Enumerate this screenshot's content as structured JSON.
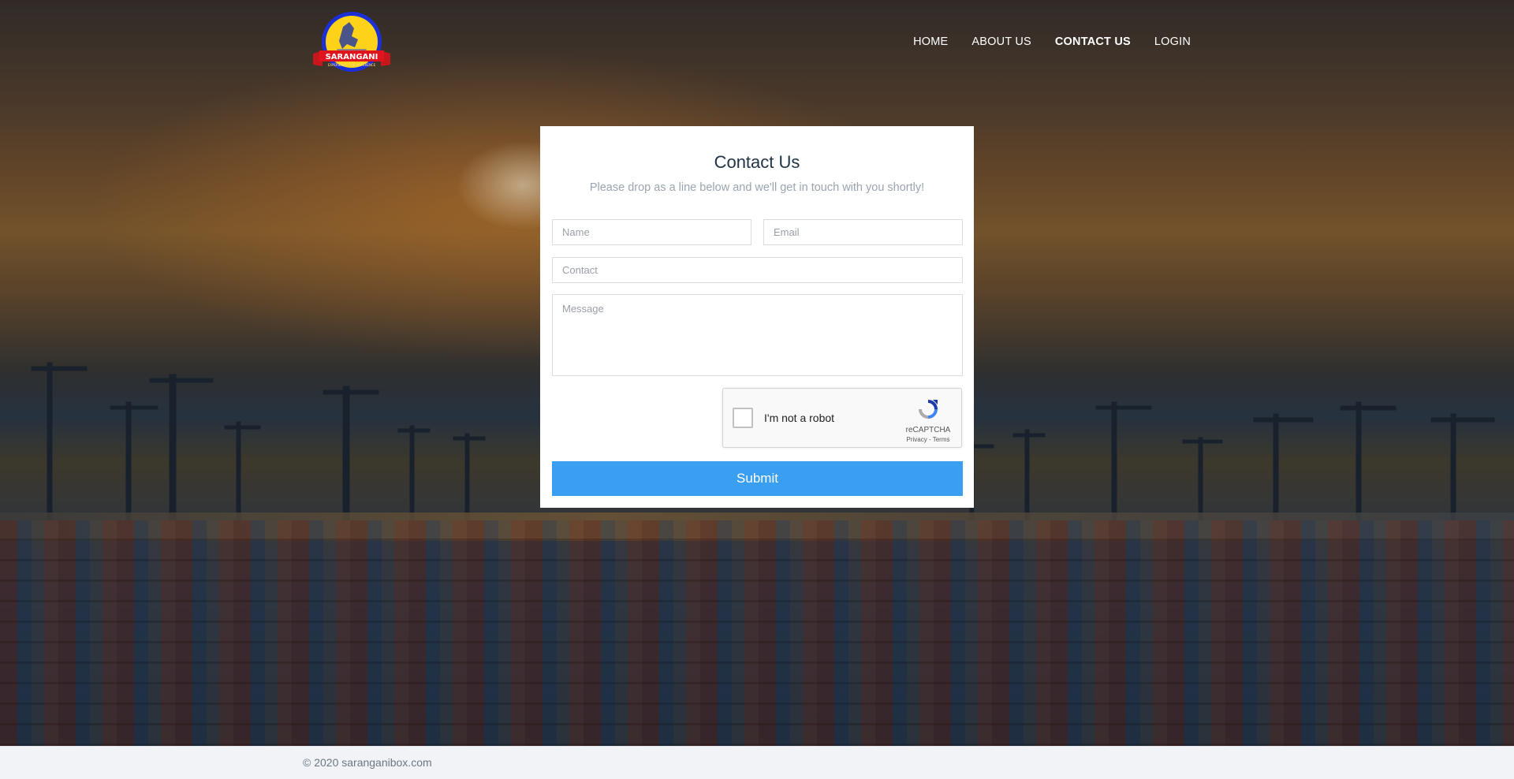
{
  "nav": {
    "items": [
      {
        "label": "HOME"
      },
      {
        "label": "ABOUT US"
      },
      {
        "label": "CONTACT US"
      },
      {
        "label": "LOGIN"
      }
    ]
  },
  "logo": {
    "text": "SARANGANI",
    "tagline": "EXPERIENCE THE DIFFERENCE"
  },
  "contact": {
    "title": "Contact Us",
    "subtitle": "Please drop as a line below and we'll get in touch with you shortly!",
    "name_placeholder": "Name",
    "email_placeholder": "Email",
    "contact_placeholder": "Contact",
    "message_placeholder": "Message",
    "submit_label": "Submit"
  },
  "recaptcha": {
    "label": "I'm not a robot",
    "brand": "reCAPTCHA",
    "links": "Privacy - Terms"
  },
  "footer": {
    "copyright": "© 2020 saranganibox.com"
  }
}
